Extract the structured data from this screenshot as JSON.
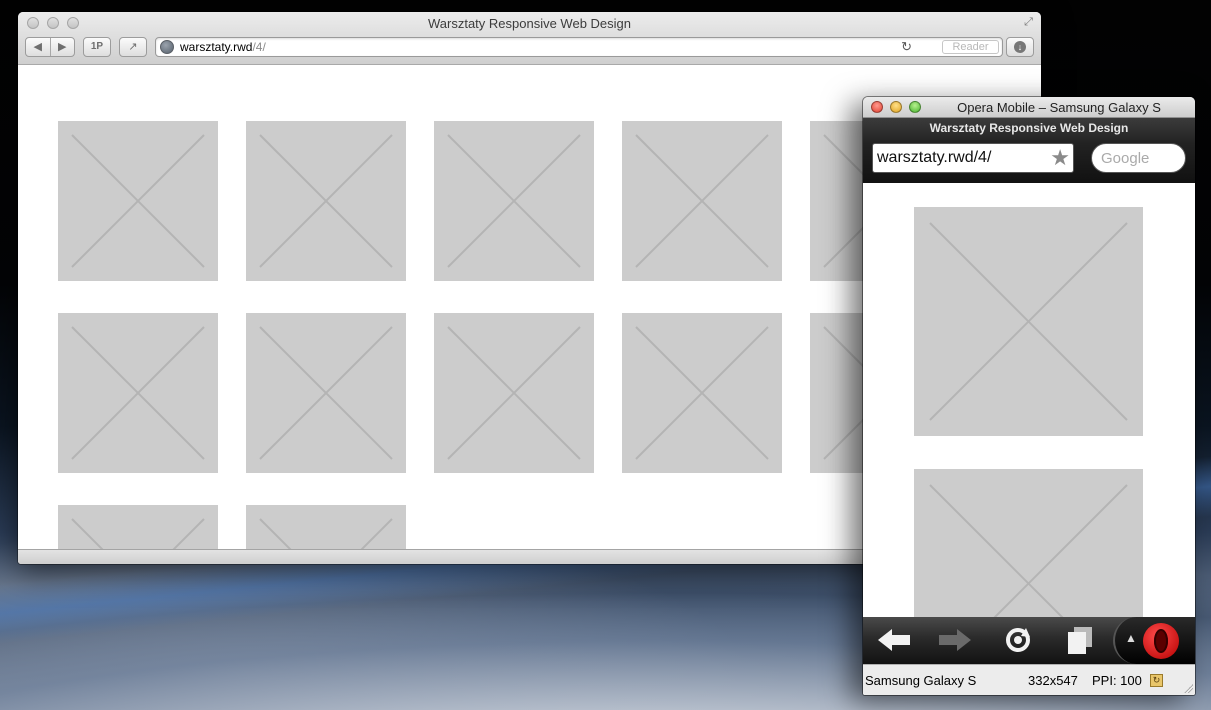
{
  "safari": {
    "title": "Warsztaty Responsive Web Design",
    "url_host": "warsztaty.rwd",
    "url_path": "/4/",
    "reader_label": "Reader",
    "onepassword_label": "1P",
    "back_glyph": "◀",
    "forward_glyph": "▶",
    "share_glyph": "↗",
    "reload_glyph": "↻",
    "download_glyph": "↓",
    "fullscreen_glyph": "⤢"
  },
  "opera": {
    "window_title": "Opera Mobile – Samsung Galaxy S",
    "page_title": "Warsztaty Responsive Web Design",
    "url": "warsztaty.rwd/4/",
    "search_placeholder": "Google",
    "star_glyph": "★",
    "menu_glyph": "▲",
    "status": {
      "device": "Samsung Galaxy S",
      "resolution": "332x547",
      "ppi": "PPI: 100"
    }
  },
  "colors": {
    "placeholder_fill": "#cccccc",
    "placeholder_stroke": "#b4b4b4",
    "opera_red": "#cc0000"
  },
  "icons": [
    "back-icon",
    "forward-icon",
    "share-icon",
    "reload-icon",
    "download-icon",
    "globe-icon",
    "star-icon",
    "refresh-icon",
    "tabs-icon",
    "opera-logo"
  ]
}
